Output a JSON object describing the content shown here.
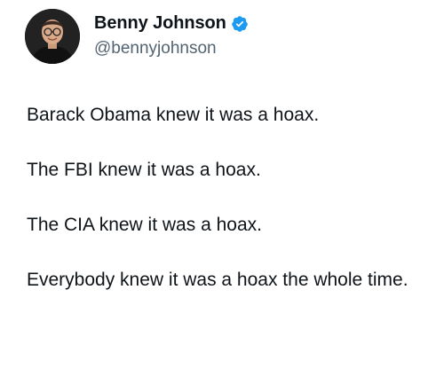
{
  "author": {
    "display_name": "Benny Johnson",
    "handle": "@bennyjohnson",
    "verified": true,
    "verified_color": "#1d9bf0",
    "avatar": "profile-photo"
  },
  "tweet": {
    "lines": [
      "Barack Obama knew it was a hoax.",
      "The FBI knew it was a hoax.",
      "The CIA knew it was a hoax.",
      "Everybody knew it was a hoax the whole time."
    ]
  }
}
